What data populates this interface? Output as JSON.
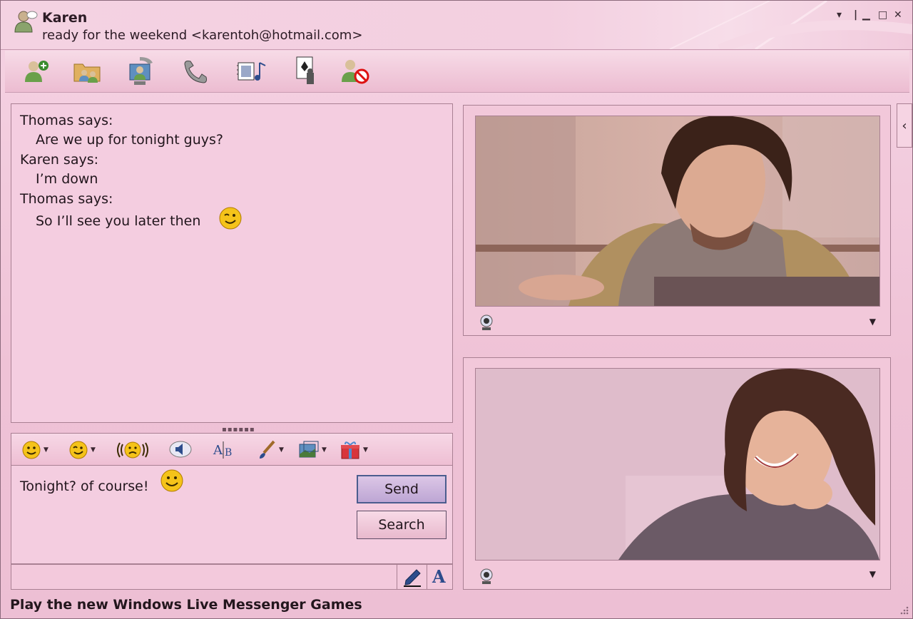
{
  "window": {
    "contact_name": "Karen",
    "contact_status": "ready for the weekend <karentoh@hotmail.com>",
    "controls": {
      "menu": "▾",
      "minimize": "▁",
      "maximize": "□",
      "close": "✕"
    }
  },
  "toolbar": {
    "icons": [
      "add-contact-icon",
      "share-folder-icon",
      "video-call-icon",
      "voice-call-icon",
      "activities-icon",
      "games-icon",
      "block-icon"
    ]
  },
  "conversation": {
    "messages": [
      {
        "sender": "Thomas says:",
        "text": "Are we up for tonight guys?"
      },
      {
        "sender": "Karen says:",
        "text": "I’m down"
      },
      {
        "sender": "Thomas says:",
        "text": "So I’ll see you later then",
        "emoticon": "wink-icon"
      }
    ]
  },
  "format_toolbar": {
    "icons": [
      "emoticon-icon",
      "wink-emoticon-icon",
      "nudge-icon",
      "voice-clip-icon",
      "font-icon",
      "background-icon",
      "send-picture-icon",
      "gift-icon"
    ]
  },
  "input": {
    "text": "Tonight? of course!",
    "emoticon": "smile-icon",
    "send_label": "Send",
    "search_label": "Search"
  },
  "bottom": {
    "handwriting_icon": "pen-icon",
    "text_icon_label": "A"
  },
  "advert": "Play the new Windows Live Messenger Games",
  "video": {
    "top_dropdown": "▼",
    "bottom_dropdown": "▼",
    "collapse_label": "‹"
  },
  "colors": {
    "background": "#f2c6da",
    "accent": "#4b5d8e"
  }
}
